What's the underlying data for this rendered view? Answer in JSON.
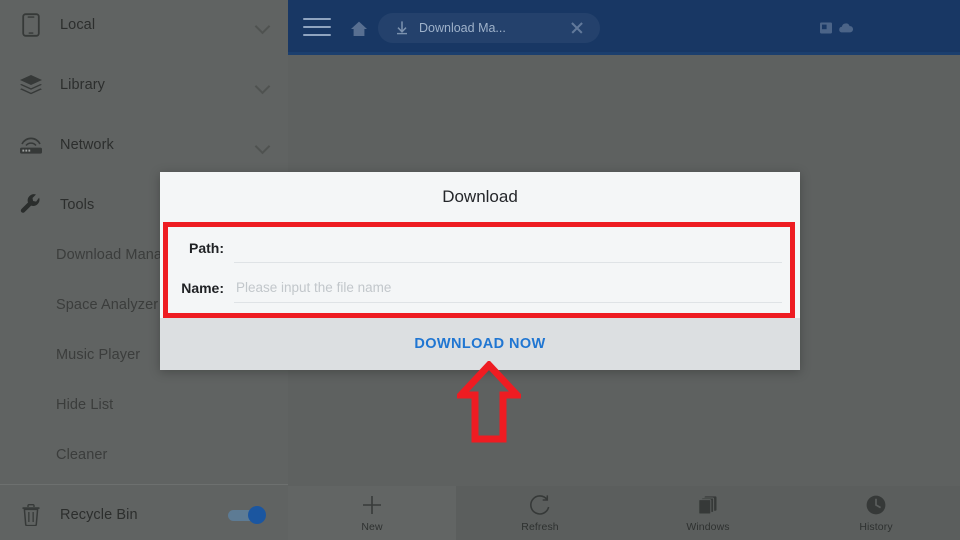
{
  "header": {
    "menu_icon": "hamburger-icon",
    "home_icon": "home-icon",
    "tab": {
      "icon": "download-arrow-icon",
      "label": "Download Ma...",
      "close_icon": "close-icon"
    },
    "buttons": [
      {
        "icon": "bookmark-icon"
      },
      {
        "icon": "cloud-icon"
      }
    ]
  },
  "sidebar": {
    "items": [
      {
        "label": "Local",
        "icon": "phone-device-icon",
        "chevron": true,
        "sub": false
      },
      {
        "label": "Library",
        "icon": "layers-icon",
        "chevron": true,
        "sub": false
      },
      {
        "label": "Network",
        "icon": "router-icon",
        "chevron": true,
        "sub": false
      },
      {
        "label": "Tools",
        "icon": "wrench-icon",
        "chevron": false,
        "sub": false
      },
      {
        "label": "Download Mana",
        "icon": "",
        "chevron": false,
        "sub": true
      },
      {
        "label": "Space Analyzer",
        "icon": "",
        "chevron": false,
        "sub": true
      },
      {
        "label": "Music Player",
        "icon": "",
        "chevron": false,
        "sub": true
      },
      {
        "label": "Hide List",
        "icon": "",
        "chevron": false,
        "sub": true
      },
      {
        "label": "Cleaner",
        "icon": "",
        "chevron": false,
        "sub": true
      }
    ],
    "footer_item": {
      "label": "Recycle Bin",
      "icon": "trash-icon",
      "toggle_on": true
    }
  },
  "bottombar": {
    "items": [
      {
        "label": "New",
        "icon": "plus-icon",
        "active": true
      },
      {
        "label": "Refresh",
        "icon": "refresh-icon",
        "active": false
      },
      {
        "label": "Windows",
        "icon": "windows-stack-icon",
        "active": false
      },
      {
        "label": "History",
        "icon": "clock-icon",
        "active": false
      }
    ]
  },
  "dialog": {
    "title": "Download",
    "fields": [
      {
        "label": "Path:",
        "value": "",
        "placeholder": ""
      },
      {
        "label": "Name:",
        "value": "",
        "placeholder": "Please input the file name"
      }
    ],
    "action_label": "DOWNLOAD NOW"
  },
  "annotations": {
    "highlight_box_color": "#ee1c22",
    "arrow_color": "#ee1c22",
    "arrow_direction": "up",
    "arrow_points_to": "DOWNLOAD NOW"
  },
  "colors": {
    "header_blue": "#183764",
    "sidebar_gray": "#606362",
    "dialog_bg": "#f4f6f7",
    "action_blue": "#2076d2",
    "toggle_blue": "#1b56a0"
  }
}
